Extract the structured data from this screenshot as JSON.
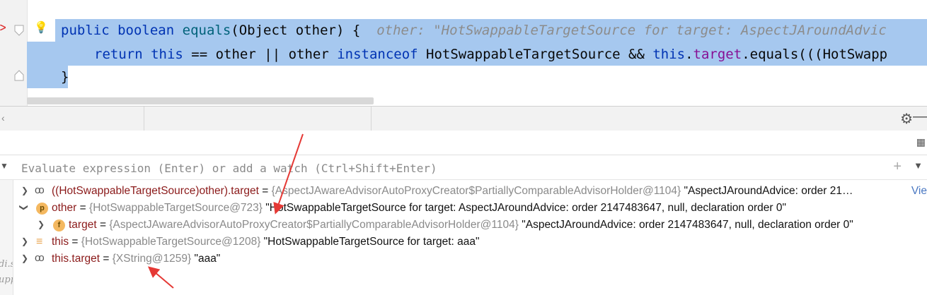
{
  "editor": {
    "line1": {
      "kw1": "public",
      "kw2": "boolean",
      "method": "equals",
      "rest": "(Object other) {",
      "hint": "other: \"HotSwappableTargetSource for target: AspectJAroundAdvic"
    },
    "line2": {
      "ret": "return",
      "this1": "this",
      "mid1": " == other || other ",
      "inst": "instanceof",
      "mid2": " HotSwappableTargetSource && ",
      "this2": "this",
      "dot": ".",
      "field": "target",
      "tail": ".equals(((HotSwapp"
    },
    "line3": "}"
  },
  "evaluate": {
    "placeholder": "Evaluate expression (Enter) or add a watch (Ctrl+Shift+Enter)"
  },
  "variables": [
    {
      "icon": "watch-icon",
      "expanded": false,
      "name": "((HotSwappableTargetSource)other).target",
      "eq": " = ",
      "type": "{AspectJAwareAdvisorAutoProxyCreator$PartiallyComparableAdvisorHolder@1104}",
      "value": " \"AspectJAroundAdvice: order 21…",
      "link": "Vie"
    },
    {
      "icon": "parameter-icon",
      "badge": "p",
      "expanded": true,
      "name": "other",
      "eq": " = ",
      "type": "{HotSwappableTargetSource@723}",
      "value": " \"HotSwappableTargetSource for target: AspectJAroundAdvice: order 2147483647, null, declaration order 0\""
    },
    {
      "icon": "field-icon",
      "badge": "f",
      "expanded": false,
      "name": "target",
      "eq": " = ",
      "type": "{AspectJAwareAdvisorAutoProxyCreator$PartiallyComparableAdvisorHolder@1104}",
      "value": " \"AspectJAroundAdvice: order 2147483647, null, declaration order 0\""
    },
    {
      "icon": "static-icon",
      "expanded": false,
      "name": "this",
      "eq": " = ",
      "type": "{HotSwappableTargetSource@1208}",
      "value": " \"HotSwappableTargetSource for target: aaa\""
    },
    {
      "icon": "watch-icon",
      "expanded": false,
      "name": "this.target",
      "eq": " = ",
      "type": "{XString@1259}",
      "value": " \"aaa\""
    }
  ],
  "leftpane": {
    "frag1": "di.s",
    "frag2": "upp"
  },
  "colors": {
    "selection": "#a6c8ef",
    "keyword": "#0033b3",
    "field": "#871094",
    "annotation_arrow": "#e53935"
  }
}
